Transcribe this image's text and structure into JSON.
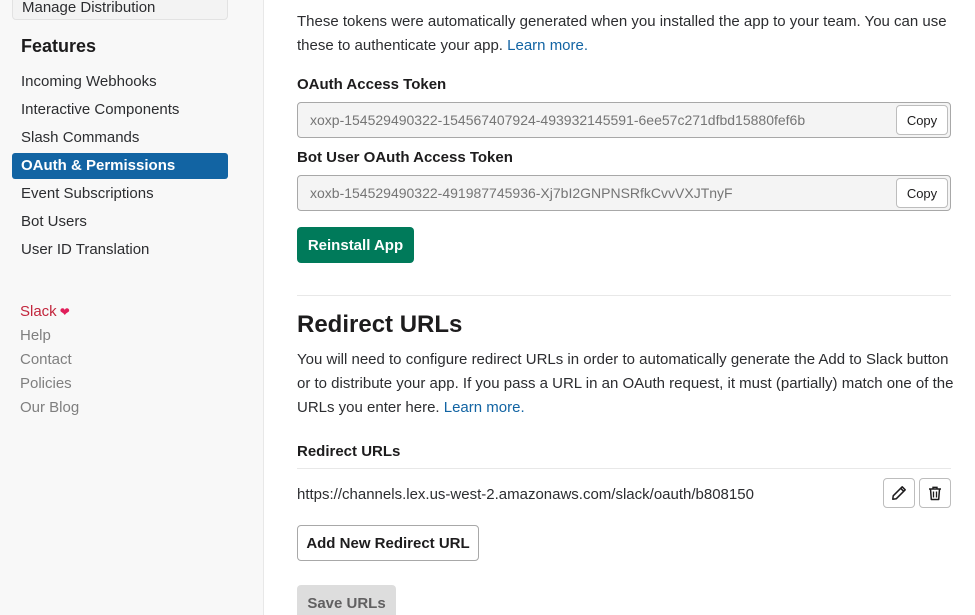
{
  "sidebar": {
    "previous_item": "Manage Distribution",
    "features_heading": "Features",
    "items": [
      {
        "label": "Incoming Webhooks"
      },
      {
        "label": "Interactive Components"
      },
      {
        "label": "Slash Commands"
      },
      {
        "label": "OAuth & Permissions"
      },
      {
        "label": "Event Subscriptions"
      },
      {
        "label": "Bot Users"
      },
      {
        "label": "User ID Translation"
      }
    ],
    "active_item": "OAuth & Permissions",
    "footer_links": [
      {
        "label": "Slack"
      },
      {
        "label": "Help"
      },
      {
        "label": "Contact"
      },
      {
        "label": "Policies"
      },
      {
        "label": "Our Blog"
      }
    ],
    "heart_icon": "heart-icon"
  },
  "tokens": {
    "intro_text": "These tokens were automatically generated when you installed the app to your team. You can use these to authenticate your app.",
    "learn_more": "Learn more.",
    "oauth_label": "OAuth Access Token",
    "oauth_value": "xoxp-154529490322-154567407924-493932145591-6ee57c271dfbd15880fef6b",
    "bot_label": "Bot User OAuth Access Token",
    "bot_value": "xoxb-154529490322-491987745936-Xj7bI2GNPNSRfkCvvVXJTnyF",
    "copy_label": "Copy",
    "reinstall_label": "Reinstall App"
  },
  "redirect": {
    "title": "Redirect URLs",
    "description": "You will need to configure redirect URLs in order to automatically generate the Add to Slack button or to distribute your app. If you pass a URL in an OAuth request, it must (partially) match one of the URLs you enter here.",
    "learn_more": "Learn more.",
    "list_header": "Redirect URLs",
    "urls": [
      "https://channels.lex.us-west-2.amazonaws.com/slack/oauth/b808150"
    ],
    "add_label": "Add New Redirect URL",
    "save_label": "Save URLs"
  },
  "colors": {
    "active_nav": "#1264a3",
    "primary_button": "#007a5a",
    "link": "#1264a3",
    "slack_link": "#c2263d"
  }
}
